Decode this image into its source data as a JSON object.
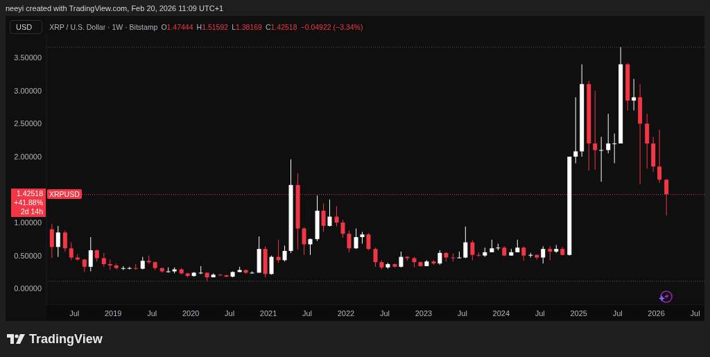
{
  "top_bar": {
    "text": "neeyi created with TradingView.com, Feb 20, 2026 11:09 UTC+1"
  },
  "currency_button": {
    "label": "USD"
  },
  "legend": {
    "title": "XRP / U.S. Dollar · 1W · Bitstamp",
    "ohlc": [
      {
        "label": "O",
        "value": "1.47444"
      },
      {
        "label": "H",
        "value": "1.51592"
      },
      {
        "label": "L",
        "value": "1.38169"
      },
      {
        "label": "C",
        "value": "1.42518"
      }
    ],
    "change": "−0.04922 (−3.34%)"
  },
  "price_label": {
    "price": "1.42518",
    "change": "+41.88%",
    "countdown": "2d 14h",
    "symbol": "XRPUSD"
  },
  "chart_data": {
    "type": "candlestick",
    "xlim": [
      2018.14,
      2026.62
    ],
    "ylim": [
      -0.25,
      3.85
    ],
    "yticks": [
      {
        "value": 0,
        "label": "0.00000"
      },
      {
        "value": 0.5,
        "label": "0.50000"
      },
      {
        "value": 1,
        "label": "1.00000"
      },
      {
        "value": 2,
        "label": "2.00000"
      },
      {
        "value": 2.5,
        "label": "2.50000"
      },
      {
        "value": 3,
        "label": "3.00000"
      },
      {
        "value": 3.5,
        "label": "3.50000"
      }
    ],
    "ref_lines": [
      {
        "axis": "y",
        "value": 3.66,
        "color": "#555555"
      },
      {
        "axis": "y",
        "value": 0.11,
        "color": "#555555"
      },
      {
        "axis": "y",
        "value": 1.42518,
        "color": "#f23645"
      }
    ],
    "xticks": [
      {
        "value": 2018.5,
        "label": "Jul"
      },
      {
        "value": 2019,
        "label": "2019"
      },
      {
        "value": 2019.5,
        "label": "Jul"
      },
      {
        "value": 2020,
        "label": "2020"
      },
      {
        "value": 2020.5,
        "label": "Jul"
      },
      {
        "value": 2021,
        "label": "2021"
      },
      {
        "value": 2021.5,
        "label": "Jul"
      },
      {
        "value": 2022,
        "label": "2022"
      },
      {
        "value": 2022.5,
        "label": "Jul"
      },
      {
        "value": 2023,
        "label": "2023"
      },
      {
        "value": 2023.5,
        "label": "Jul"
      },
      {
        "value": 2024,
        "label": "2024"
      },
      {
        "value": 2024.5,
        "label": "Jul"
      },
      {
        "value": 2025,
        "label": "2025"
      },
      {
        "value": 2025.5,
        "label": "Jul"
      },
      {
        "value": 2026,
        "label": "2026"
      },
      {
        "value": 2026.5,
        "label": "Jul"
      }
    ],
    "x": [
      2018.21,
      2018.29,
      2018.38,
      2018.46,
      2018.54,
      2018.63,
      2018.71,
      2018.79,
      2018.88,
      2018.96,
      2019.04,
      2019.13,
      2019.21,
      2019.29,
      2019.38,
      2019.46,
      2019.54,
      2019.63,
      2019.71,
      2019.79,
      2019.88,
      2019.96,
      2020.04,
      2020.13,
      2020.21,
      2020.29,
      2020.38,
      2020.46,
      2020.54,
      2020.63,
      2020.71,
      2020.79,
      2020.88,
      2020.96,
      2021.04,
      2021.13,
      2021.21,
      2021.29,
      2021.38,
      2021.46,
      2021.54,
      2021.63,
      2021.71,
      2021.79,
      2021.88,
      2021.96,
      2022.04,
      2022.13,
      2022.21,
      2022.29,
      2022.38,
      2022.46,
      2022.54,
      2022.63,
      2022.71,
      2022.79,
      2022.88,
      2022.96,
      2023.04,
      2023.13,
      2023.21,
      2023.29,
      2023.38,
      2023.46,
      2023.54,
      2023.63,
      2023.71,
      2023.79,
      2023.88,
      2023.96,
      2024.04,
      2024.13,
      2024.21,
      2024.29,
      2024.38,
      2024.46,
      2024.54,
      2024.63,
      2024.71,
      2024.79,
      2024.88,
      2024.96,
      2025.04,
      2025.13,
      2025.21,
      2025.29,
      2025.38,
      2025.46,
      2025.54,
      2025.63,
      2025.71,
      2025.79,
      2025.88,
      2025.96,
      2026.04,
      2026.13
    ],
    "ohlc": [
      [
        0.9,
        0.98,
        0.46,
        0.63
      ],
      [
        0.63,
        0.95,
        0.48,
        0.85
      ],
      [
        0.85,
        0.88,
        0.56,
        0.61
      ],
      [
        0.61,
        0.7,
        0.43,
        0.47
      ],
      [
        0.47,
        0.52,
        0.42,
        0.44
      ],
      [
        0.44,
        0.45,
        0.25,
        0.33
      ],
      [
        0.33,
        0.78,
        0.26,
        0.58
      ],
      [
        0.58,
        0.59,
        0.41,
        0.46
      ],
      [
        0.46,
        0.54,
        0.33,
        0.37
      ],
      [
        0.37,
        0.44,
        0.28,
        0.35
      ],
      [
        0.35,
        0.38,
        0.29,
        0.31
      ],
      [
        0.31,
        0.34,
        0.28,
        0.31
      ],
      [
        0.31,
        0.33,
        0.29,
        0.31
      ],
      [
        0.31,
        0.37,
        0.28,
        0.3
      ],
      [
        0.3,
        0.48,
        0.29,
        0.42
      ],
      [
        0.42,
        0.5,
        0.37,
        0.4
      ],
      [
        0.4,
        0.41,
        0.28,
        0.31
      ],
      [
        0.31,
        0.32,
        0.24,
        0.26
      ],
      [
        0.26,
        0.32,
        0.24,
        0.26
      ],
      [
        0.26,
        0.32,
        0.23,
        0.29
      ],
      [
        0.29,
        0.31,
        0.21,
        0.23
      ],
      [
        0.23,
        0.24,
        0.17,
        0.19
      ],
      [
        0.19,
        0.25,
        0.18,
        0.24
      ],
      [
        0.24,
        0.34,
        0.22,
        0.24
      ],
      [
        0.24,
        0.24,
        0.11,
        0.17
      ],
      [
        0.17,
        0.23,
        0.17,
        0.21
      ],
      [
        0.21,
        0.22,
        0.19,
        0.2
      ],
      [
        0.2,
        0.21,
        0.17,
        0.18
      ],
      [
        0.18,
        0.26,
        0.17,
        0.25
      ],
      [
        0.25,
        0.33,
        0.25,
        0.28
      ],
      [
        0.28,
        0.29,
        0.22,
        0.24
      ],
      [
        0.24,
        0.26,
        0.23,
        0.24
      ],
      [
        0.24,
        0.79,
        0.24,
        0.6
      ],
      [
        0.6,
        0.64,
        0.17,
        0.22
      ],
      [
        0.22,
        0.5,
        0.21,
        0.48
      ],
      [
        0.48,
        0.74,
        0.39,
        0.43
      ],
      [
        0.43,
        0.65,
        0.41,
        0.57
      ],
      [
        0.57,
        1.96,
        0.54,
        1.57
      ],
      [
        1.57,
        1.75,
        0.59,
        0.91
      ],
      [
        0.91,
        0.93,
        0.51,
        0.67
      ],
      [
        0.67,
        0.76,
        0.51,
        0.75
      ],
      [
        0.75,
        1.41,
        0.72,
        1.18
      ],
      [
        1.18,
        1.29,
        0.86,
        0.95
      ],
      [
        0.95,
        1.35,
        0.94,
        1.09
      ],
      [
        1.09,
        1.25,
        0.94,
        1.0
      ],
      [
        1.0,
        1.04,
        0.77,
        0.83
      ],
      [
        0.83,
        0.88,
        0.55,
        0.61
      ],
      [
        0.61,
        0.91,
        0.6,
        0.78
      ],
      [
        0.78,
        0.86,
        0.68,
        0.82
      ],
      [
        0.82,
        0.84,
        0.58,
        0.6
      ],
      [
        0.6,
        0.62,
        0.33,
        0.4
      ],
      [
        0.4,
        0.43,
        0.29,
        0.32
      ],
      [
        0.32,
        0.39,
        0.3,
        0.37
      ],
      [
        0.37,
        0.38,
        0.32,
        0.33
      ],
      [
        0.33,
        0.56,
        0.32,
        0.48
      ],
      [
        0.48,
        0.49,
        0.42,
        0.46
      ],
      [
        0.46,
        0.48,
        0.32,
        0.4
      ],
      [
        0.4,
        0.41,
        0.33,
        0.34
      ],
      [
        0.34,
        0.43,
        0.34,
        0.41
      ],
      [
        0.41,
        0.43,
        0.36,
        0.38
      ],
      [
        0.38,
        0.58,
        0.36,
        0.54
      ],
      [
        0.54,
        0.55,
        0.41,
        0.47
      ],
      [
        0.47,
        0.53,
        0.41,
        0.46
      ],
      [
        0.46,
        0.56,
        0.46,
        0.47
      ],
      [
        0.47,
        0.94,
        0.46,
        0.7
      ],
      [
        0.7,
        0.73,
        0.43,
        0.51
      ],
      [
        0.51,
        0.55,
        0.48,
        0.5
      ],
      [
        0.5,
        0.62,
        0.48,
        0.55
      ],
      [
        0.55,
        0.74,
        0.55,
        0.61
      ],
      [
        0.61,
        0.68,
        0.58,
        0.62
      ],
      [
        0.62,
        0.64,
        0.49,
        0.5
      ],
      [
        0.5,
        0.6,
        0.5,
        0.55
      ],
      [
        0.55,
        0.74,
        0.55,
        0.62
      ],
      [
        0.62,
        0.64,
        0.42,
        0.5
      ],
      [
        0.5,
        0.54,
        0.47,
        0.51
      ],
      [
        0.51,
        0.52,
        0.44,
        0.47
      ],
      [
        0.47,
        0.64,
        0.38,
        0.6
      ],
      [
        0.6,
        0.64,
        0.43,
        0.56
      ],
      [
        0.56,
        0.66,
        0.54,
        0.6
      ],
      [
        0.6,
        0.63,
        0.5,
        0.51
      ],
      [
        0.51,
        2.0,
        0.5,
        2.0
      ],
      [
        2.0,
        2.9,
        1.9,
        2.08
      ],
      [
        2.08,
        3.4,
        2.0,
        3.1
      ],
      [
        3.1,
        3.15,
        1.79,
        2.2
      ],
      [
        2.2,
        3.0,
        1.8,
        2.1
      ],
      [
        2.1,
        2.3,
        1.62,
        2.1
      ],
      [
        2.1,
        2.65,
        2.05,
        2.2
      ],
      [
        2.2,
        2.35,
        1.9,
        2.2
      ],
      [
        2.2,
        3.66,
        2.2,
        3.4
      ],
      [
        3.4,
        3.42,
        2.7,
        2.85
      ],
      [
        2.85,
        3.18,
        2.7,
        2.9
      ],
      [
        2.9,
        3.1,
        1.58,
        2.5
      ],
      [
        2.5,
        2.65,
        1.82,
        2.2
      ],
      [
        2.2,
        2.3,
        1.77,
        1.85
      ],
      [
        1.85,
        2.41,
        1.6,
        1.65
      ],
      [
        1.65,
        1.66,
        1.11,
        1.43
      ]
    ]
  },
  "footer": {
    "brand": "TradingView"
  }
}
